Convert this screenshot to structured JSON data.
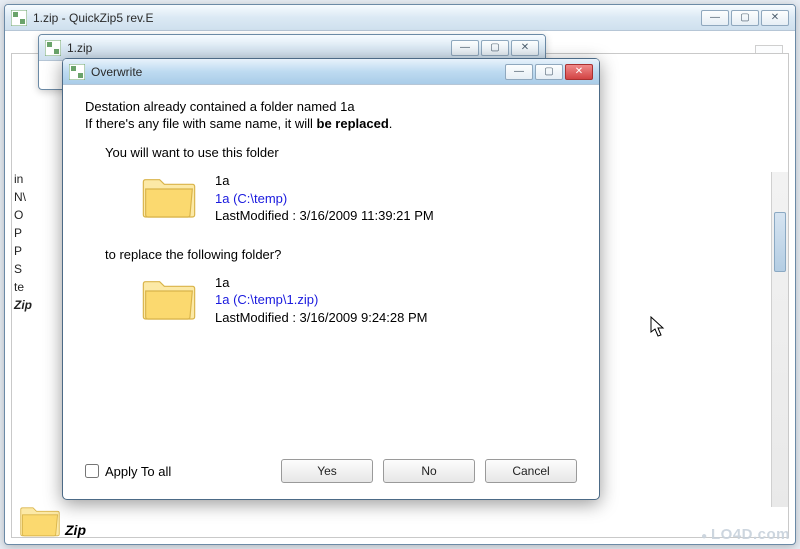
{
  "outer_window": {
    "title": "1.zip - QuickZip5 rev.E"
  },
  "mid_window": {
    "title": "1.zip"
  },
  "dialog": {
    "title": "Overwrite",
    "message_line1": "Destation already contained a folder named 1a",
    "message_line2_pre": "If there's any file with same name, it will ",
    "message_line2_bold": "be replaced",
    "message_line2_post": ".",
    "use_folder_heading": "You will want to use this folder",
    "replace_heading": "to replace the following folder?",
    "source": {
      "name": "1a",
      "path": "1a (C:\\temp)",
      "modified": "LastModified : 3/16/2009 11:39:21 PM"
    },
    "target": {
      "name": "1a",
      "path": "1a (C:\\temp\\1.zip)",
      "modified": "LastModified : 3/16/2009 9:24:28 PM"
    },
    "apply_all_label": "Apply To all",
    "buttons": {
      "yes": "Yes",
      "no": "No",
      "cancel": "Cancel"
    }
  },
  "sidebar_fragments": [
    "in",
    "N\\",
    "O",
    "P",
    "P",
    "S",
    "te",
    "Zip"
  ],
  "zip_corner_label": "Zip",
  "watermark": "LO4D.com"
}
